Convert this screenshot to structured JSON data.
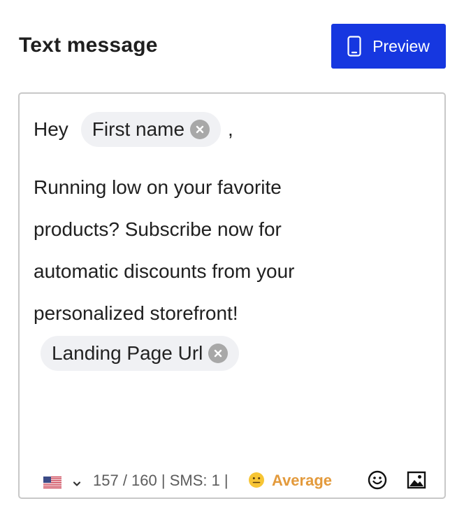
{
  "header": {
    "title": "Text message",
    "preview_label": "Preview"
  },
  "message": {
    "greeting": "Hey",
    "first_name_tag": "First name",
    "comma": ",",
    "body_lines": [
      "Running low on your favorite",
      "products? Subscribe now for",
      "automatic discounts from your",
      "personalized storefront!"
    ],
    "url_tag": "Landing Page Url"
  },
  "footer": {
    "counter": "157 / 160 | SMS: 1 |",
    "quality": "Average",
    "quality_color": "#e39a3c",
    "country_icon": "us-flag-icon",
    "emoji_icon": "smiley-icon",
    "image_icon": "image-icon"
  },
  "colors": {
    "accent": "#1637e0",
    "chip_bg": "#f0f1f4",
    "chip_remove": "#a8a8a8"
  }
}
